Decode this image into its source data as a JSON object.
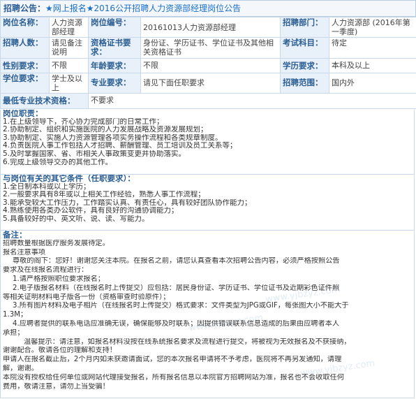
{
  "header": {
    "label": "招聘公告：",
    "title": "★网上报名★2016公开招聘人力资源部经理岗位公告"
  },
  "fields": {
    "post_name_label": "岗位名称：",
    "post_name": "人力资源部经理",
    "post_code_label": "岗位编号：",
    "post_code": "20161013人力资源部经理",
    "dept_label": "招聘部门：",
    "dept": "人力资源部 (2016年第一季度)",
    "count_label": "招聘人数：",
    "count": "请见备注说明",
    "cert_label": "资格证书要求：",
    "cert": "身份证、学历证书、学位证书及其他相关资格证书",
    "exam_label": "考试科目：",
    "exam": "待定",
    "gender_label": "性别要求：",
    "gender": "不限",
    "age_label": "年龄要求：",
    "age": "不限",
    "edu_label": "学历要求：",
    "edu": "本科及以上",
    "degree_label": "学位要求：",
    "degree": "学士及以上",
    "major_label": "专业要求：",
    "major": "请见下面任职要求",
    "scope_label": "招聘范围：",
    "scope": "国内外",
    "skill_label": "最低专业技术资格：",
    "skill": "不要求"
  },
  "duties": {
    "title": "岗位职责：",
    "items": [
      "1.在上级领导下，齐心协力完成部门的日常工作；",
      "2.协助制定、组织和实施医院的人力发展战略及资源发展规划；",
      "3.协助制定、实施人力资源管理各项实务操作流程和各类规章制度。",
      "4.负责医院人事工作包括人才招聘、薪酬管理、员工培训及员工关系等；",
      "5.及时掌握国家、省、市相关人事政策变更并协助落实。",
      "6.完成上级领导交办的其他工作。"
    ]
  },
  "reqs": {
    "title": "与岗位有关的其它条件（任职要求）：",
    "items": [
      "1.全日制本科或以上学历；",
      "2.一般要求具有8年或以上相关工作经验，熟悉人事工作流程；",
      "3.能承受较大工作压力，工作踏实认真、有责任心，具有较好团队协作能力；",
      "4.熟练使用各类办公软件，具有良好的沟通协调能力；",
      "5.具备较好的中、英文听、说、读、写能力。"
    ]
  },
  "notes": {
    "title": "备注：",
    "lines": [
      {
        "t": "招聘数量根据医疗服务发展待定。",
        "c": ""
      },
      {
        "t": "报名注意事项",
        "c": ""
      },
      {
        "t": "尊敬的阁下：您好！谢谢您关注本院。在报名之前，请您认真查看本次招聘公告内容，必须严格按照公告",
        "c": "ind"
      },
      {
        "t": "要求及在线报名流程进行：",
        "c": ""
      },
      {
        "t": "1.请严格按照职位要求报名；",
        "c": "ind"
      },
      {
        "t": "2.电子版报名材料（在线报名时上传提交）应包括：居民身份证、学历证书、学位证书及近期彩色证件照",
        "c": "ind"
      },
      {
        "t": "等相关证明材料电子版各一份（资格审查时验原件）；",
        "c": ""
      },
      {
        "t": "3.所有图片材料及电子相片（在线报名时上传提交）格式要求：文件类型为JPG或GIF，每张图大小不能大于",
        "c": "ind"
      },
      {
        "t": "1.3M；",
        "c": ""
      },
      {
        "t": "4.应聘者提供的联系电话应准确无误，确保能够及时联系；因提供错误联系信息造成的后果由应聘者本人",
        "c": "ind"
      },
      {
        "t": "承担；",
        "c": ""
      },
      {
        "t": "温馨提示：请注意，如报名材料没按在线系统报名要求及流程进行提交，将被视为无效报名及不获接纳，",
        "c": "ind2"
      },
      {
        "t": "谢谢配合。敬请各位的理解和支持！",
        "c": ""
      },
      {
        "t": "申请人在报名截止后，2个月内如未获邀请面试，您的本次报名申请将不予考虑，医院将不再另发通知，请理",
        "c": ""
      },
      {
        "t": "解，谢谢。",
        "c": ""
      },
      {
        "t": "本院没有授权给任何单位或网站代理接受报名，所有报名信息以本院官方招聘网站为准，报名也不会收取任何",
        "c": ""
      },
      {
        "t": "费用，敬请注意，请勿上当受骗！",
        "c": ""
      }
    ]
  },
  "watermark": "www.yjbzyz.com"
}
